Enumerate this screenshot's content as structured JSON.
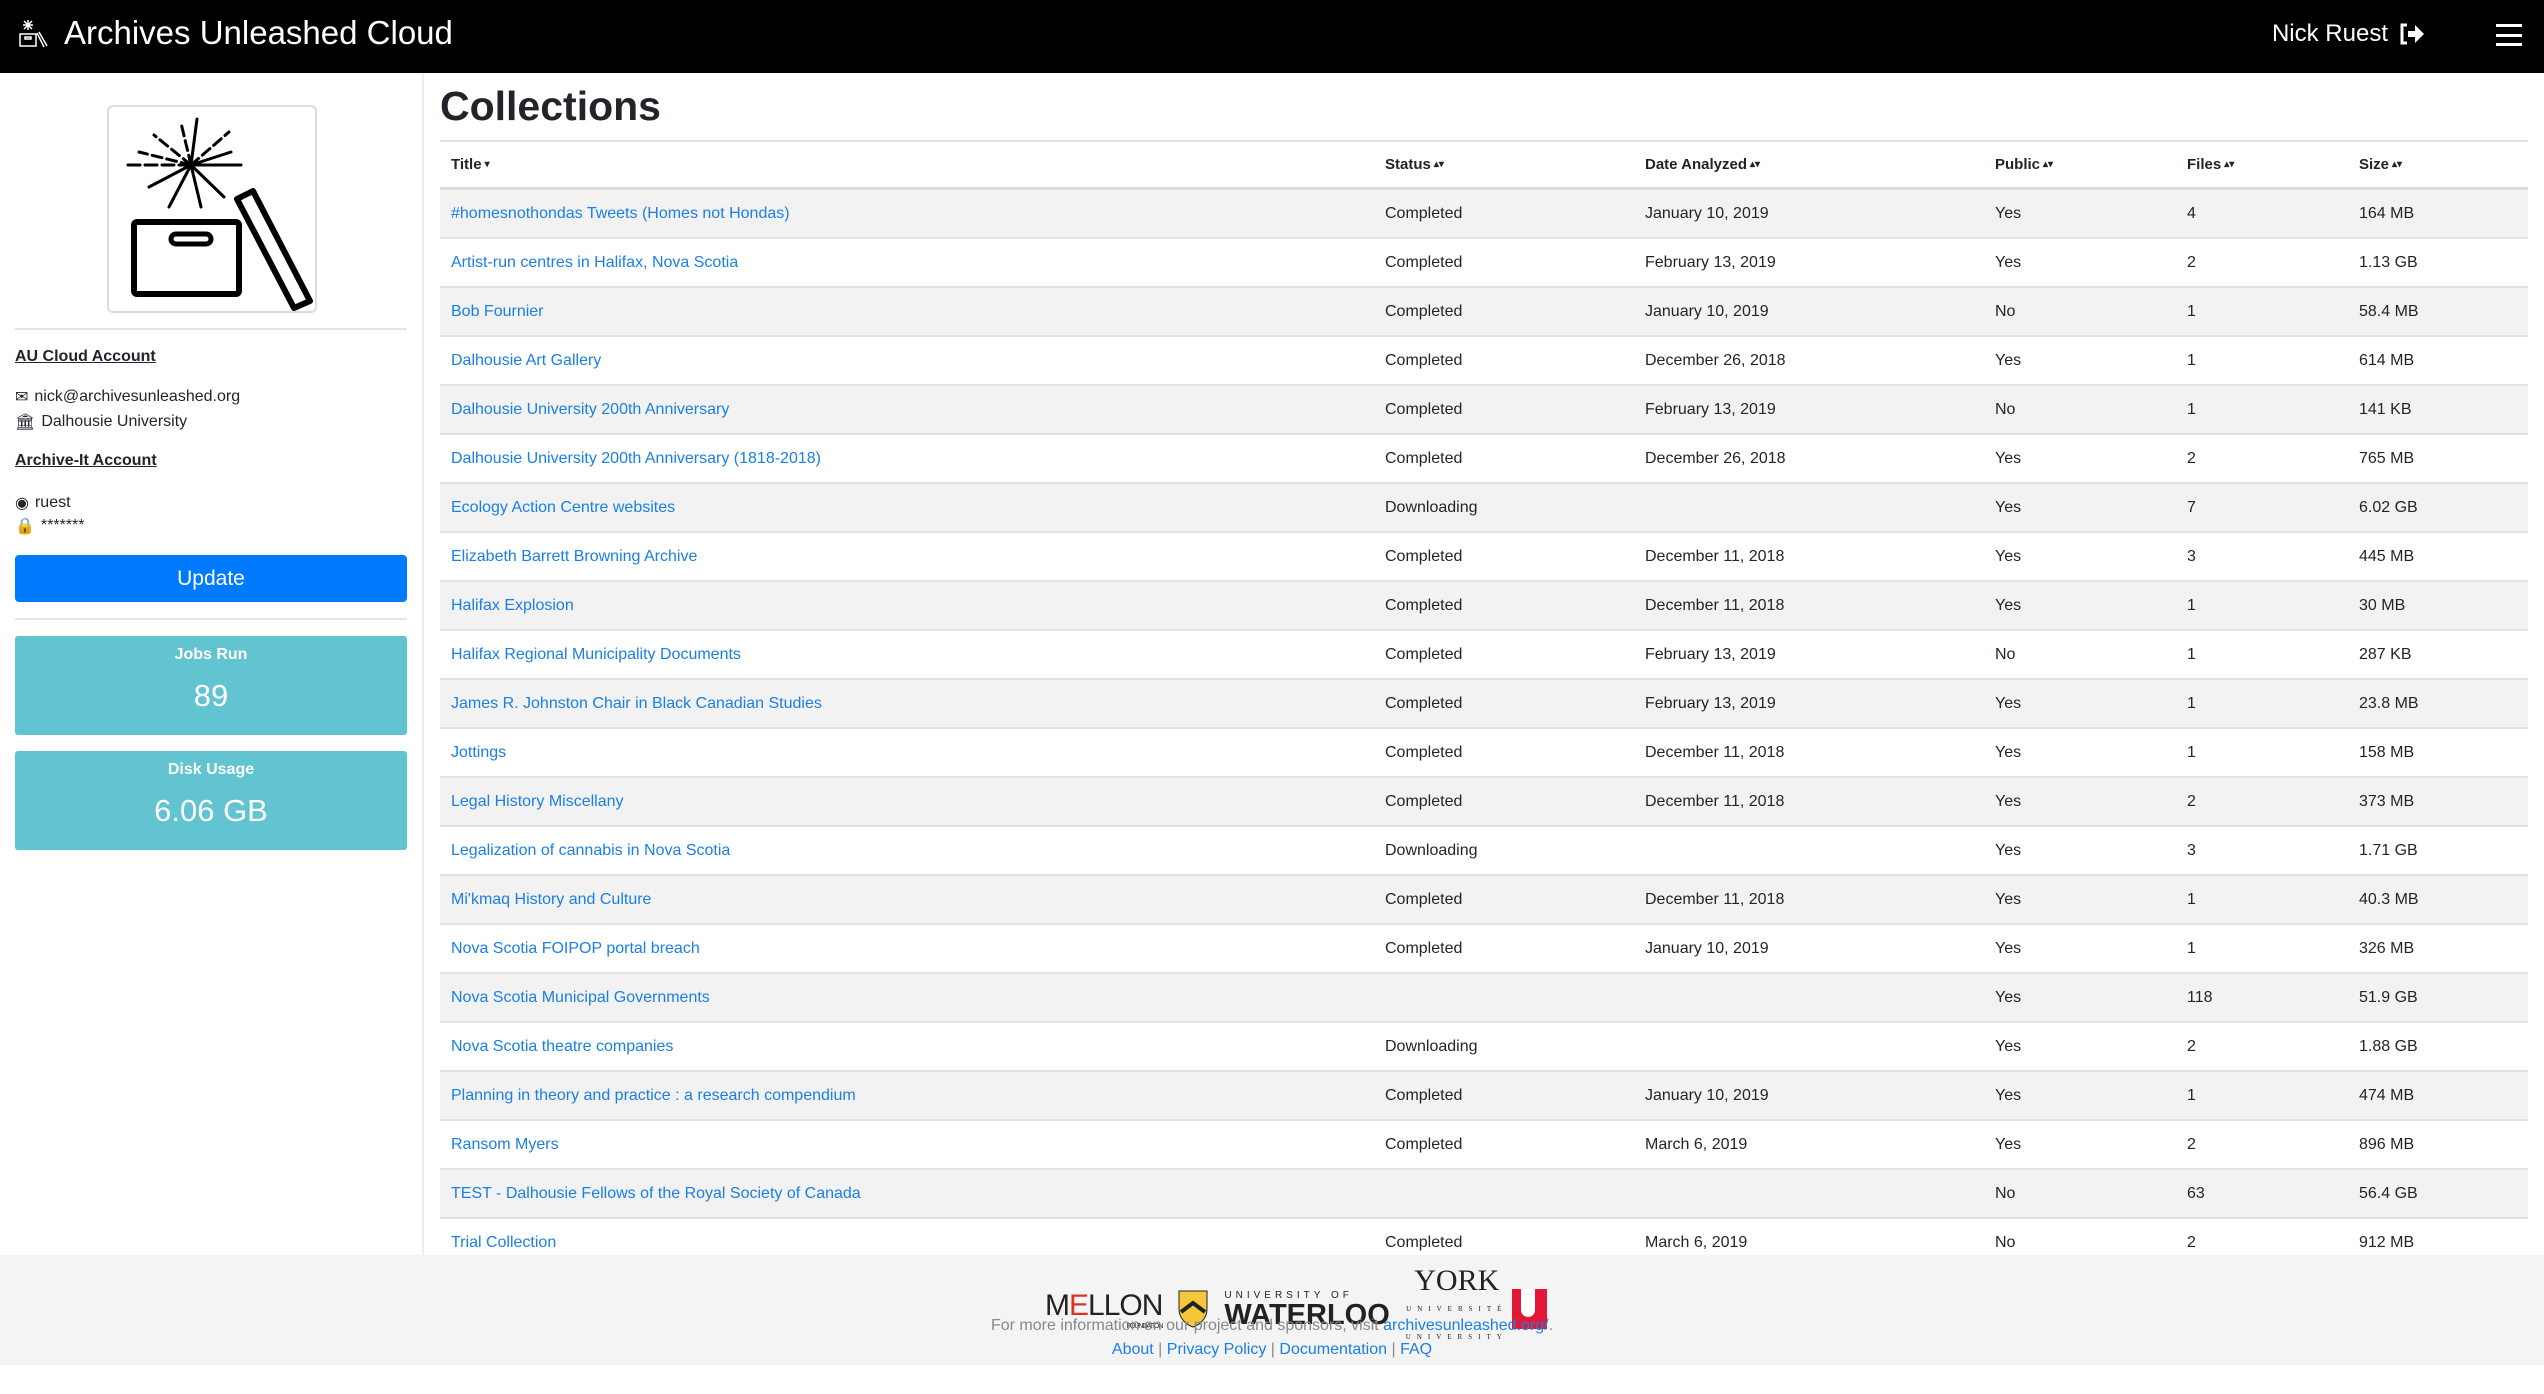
{
  "header": {
    "title": "Archives Unleashed Cloud",
    "user_name": "Nick Ruest",
    "icons": [
      "logo-box-icon",
      "sign-out-icon",
      "hamburger-menu-icon"
    ]
  },
  "sidebar": {
    "au_heading": "AU Cloud Account",
    "email": "nick@archivesunleashed.org",
    "institution": "Dalhousie University",
    "ai_heading": "Archive-It Account",
    "username": "ruest",
    "password": "*******",
    "update_label": "Update",
    "jobs_label": "Jobs Run",
    "jobs_value": "89",
    "disk_label": "Disk Usage",
    "disk_value": "6.06 GB",
    "accent": "#007bff",
    "stat_color": "#62c3d1"
  },
  "main": {
    "title": "Collections",
    "columns": [
      {
        "label": "Title",
        "sort": "▾"
      },
      {
        "label": "Status",
        "sort": "▴▾"
      },
      {
        "label": "Date Analyzed",
        "sort": "▴▾"
      },
      {
        "label": "Public",
        "sort": "▴▾"
      },
      {
        "label": "Files",
        "sort": "▴▾"
      },
      {
        "label": "Size",
        "sort": "▴▾"
      }
    ],
    "rows": [
      [
        "#homesnothondas Tweets (Homes not Hondas)",
        "Completed",
        "January 10, 2019",
        "Yes",
        "4",
        "164 MB"
      ],
      [
        "Artist-run centres in Halifax, Nova Scotia",
        "Completed",
        "February 13, 2019",
        "Yes",
        "2",
        "1.13 GB"
      ],
      [
        "Bob Fournier",
        "Completed",
        "January 10, 2019",
        "No",
        "1",
        "58.4 MB"
      ],
      [
        "Dalhousie Art Gallery",
        "Completed",
        "December 26, 2018",
        "Yes",
        "1",
        "614 MB"
      ],
      [
        "Dalhousie University 200th Anniversary",
        "Completed",
        "February 13, 2019",
        "No",
        "1",
        "141 KB"
      ],
      [
        "Dalhousie University 200th Anniversary (1818-2018)",
        "Completed",
        "December 26, 2018",
        "Yes",
        "2",
        "765 MB"
      ],
      [
        "Ecology Action Centre websites",
        "Downloading",
        "",
        "Yes",
        "7",
        "6.02 GB"
      ],
      [
        "Elizabeth Barrett Browning Archive",
        "Completed",
        "December 11, 2018",
        "Yes",
        "3",
        "445 MB"
      ],
      [
        "Halifax Explosion",
        "Completed",
        "December 11, 2018",
        "Yes",
        "1",
        "30 MB"
      ],
      [
        "Halifax Regional Municipality Documents",
        "Completed",
        "February 13, 2019",
        "No",
        "1",
        "287 KB"
      ],
      [
        "James R. Johnston Chair in Black Canadian Studies",
        "Completed",
        "February 13, 2019",
        "Yes",
        "1",
        "23.8 MB"
      ],
      [
        "Jottings",
        "Completed",
        "December 11, 2018",
        "Yes",
        "1",
        "158 MB"
      ],
      [
        "Legal History Miscellany",
        "Completed",
        "December 11, 2018",
        "Yes",
        "2",
        "373 MB"
      ],
      [
        "Legalization of cannabis in Nova Scotia",
        "Downloading",
        "",
        "Yes",
        "3",
        "1.71 GB"
      ],
      [
        "Mi'kmaq History and Culture",
        "Completed",
        "December 11, 2018",
        "Yes",
        "1",
        "40.3 MB"
      ],
      [
        "Nova Scotia FOIPOP portal breach",
        "Completed",
        "January 10, 2019",
        "Yes",
        "1",
        "326 MB"
      ],
      [
        "Nova Scotia Municipal Governments",
        "",
        "",
        "Yes",
        "118",
        "51.9 GB"
      ],
      [
        "Nova Scotia theatre companies",
        "Downloading",
        "",
        "Yes",
        "2",
        "1.88 GB"
      ],
      [
        "Planning in theory and practice : a research compendium",
        "Completed",
        "January 10, 2019",
        "Yes",
        "1",
        "474 MB"
      ],
      [
        "Ransom Myers",
        "Completed",
        "March 6, 2019",
        "Yes",
        "2",
        "896 MB"
      ],
      [
        "TEST - Dalhousie Fellows of the Royal Society of Canada",
        "",
        "",
        "No",
        "63",
        "56.4 GB"
      ],
      [
        "Trial Collection",
        "Completed",
        "March 6, 2019",
        "No",
        "2",
        "912 MB"
      ]
    ]
  },
  "footer": {
    "sponsors": [
      "MELLON FOUNDATION",
      "UNIVERSITY OF WATERLOO",
      "YORK UNIVERSITÉ UNIVERSITY"
    ],
    "info_text": "For more information on our project and sponsors, visit ",
    "info_link": "archivesunleashed.org/",
    "info_end": ".",
    "links": [
      "About",
      "Privacy Policy",
      "Documentation",
      "FAQ"
    ],
    "sep": " | "
  }
}
